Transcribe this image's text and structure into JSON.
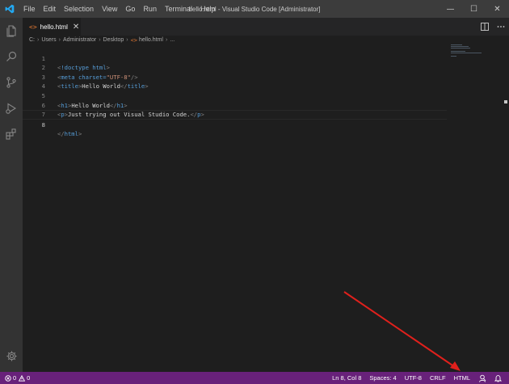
{
  "titlebar": {
    "menu": [
      "File",
      "Edit",
      "Selection",
      "View",
      "Go",
      "Run",
      "Terminal",
      "Help"
    ],
    "window_title": "hello.html - Visual Studio Code [Administrator]",
    "controls": {
      "minimize": "—",
      "maximize": "☐",
      "close": "✕"
    }
  },
  "activitybar": {
    "icons": [
      "explorer-icon",
      "search-icon",
      "source-control-icon",
      "run-debug-icon",
      "extensions-icon"
    ],
    "bottom_icon": "settings-gear-icon"
  },
  "tabs": [
    {
      "icon": "<>",
      "label": "hello.html",
      "close": "✕"
    }
  ],
  "breadcrumb": {
    "parts": [
      "C:",
      "Users",
      "Administrator",
      "Desktop",
      "hello.html",
      "..."
    ],
    "separator": "›",
    "file_icon": "<>"
  },
  "editor": {
    "lines": [
      {
        "num": "1",
        "text": "<!doctype html>"
      },
      {
        "num": "2",
        "text": "<meta charset=\"UTF-8\"/>"
      },
      {
        "num": "3",
        "text": "<title>Hello World</title>"
      },
      {
        "num": "4",
        "text": ""
      },
      {
        "num": "5",
        "text": "<h1>Hello World</h1>"
      },
      {
        "num": "6",
        "text": "<p>Just trying out Visual Studio Code.</p>"
      },
      {
        "num": "7",
        "text": ""
      },
      {
        "num": "8",
        "text": "</html>"
      }
    ],
    "current_line": 8
  },
  "statusbar": {
    "errors": "0",
    "warnings": "0",
    "position": "Ln 8, Col 8",
    "spaces": "Spaces: 4",
    "encoding": "UTF-8",
    "eol": "CRLF",
    "language": "HTML",
    "icons": [
      "error-icon",
      "warning-icon",
      "feedback-icon",
      "notifications-bell-icon"
    ]
  },
  "colors": {
    "statusbar_bg": "#68217a",
    "titlebar_bg": "#3c3c3c",
    "editor_bg": "#1e1e1e",
    "activitybar_bg": "#333333",
    "annotation_arrow": "#e0201c",
    "vscode_logo": "#23a9f2"
  }
}
